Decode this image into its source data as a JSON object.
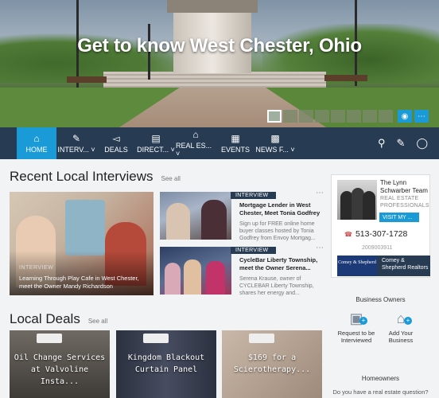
{
  "hero": {
    "title": "Get to know West Chester, Ohio",
    "camera_icon": "camera-icon",
    "more_icon": "more-icon"
  },
  "nav": {
    "items": [
      {
        "label": "HOME",
        "icon": "home-icon",
        "active": true
      },
      {
        "label": "INTERV...",
        "icon": "interviews-icon"
      },
      {
        "label": "DEALS",
        "icon": "tag-icon"
      },
      {
        "label": "DIRECT...",
        "icon": "directory-icon"
      },
      {
        "label": "REAL ES...",
        "icon": "real-estate-icon"
      },
      {
        "label": "EVENTS",
        "icon": "calendar-icon"
      },
      {
        "label": "NEWS F...",
        "icon": "news-icon"
      }
    ],
    "right_icons": [
      "search-icon",
      "edit-icon",
      "user-icon"
    ]
  },
  "interviews": {
    "title": "Recent Local Interviews",
    "see_all": "See all",
    "featured": {
      "label": "INTERVIEW",
      "title": "Learning Through Play Cafe in West Chester, meet the Owner Mandy Richardson"
    },
    "items": [
      {
        "badge": "INTERVIEW",
        "title": "Mortgage Lender in West Chester, Meet Tonia Godfrey",
        "desc": "Sign up for FREE online home buyer classes hosted by Tonia Godfrey from Envoy Mortgag..."
      },
      {
        "badge": "INTERVIEW",
        "title": "CycleBar Liberty Township, meet the Owner Serena...",
        "desc": "Serena Krause, owner of CYCLEBAR Liberty Township, shares her energy and..."
      }
    ]
  },
  "deals": {
    "title": "Local Deals",
    "see_all": "See all",
    "items": [
      {
        "text": "Oil Change Services at Valvoline Insta..."
      },
      {
        "text": "Kingdom Blackout Curtain Panel"
      },
      {
        "text": "$169 for a Scierotherapy..."
      }
    ]
  },
  "agent": {
    "name": "The Lynn Schwarber Team",
    "role": "REAL ESTATE PROFESSIONALS",
    "visit": "VISIT MY ...",
    "phone": "513-307-1728",
    "license": "2009003911",
    "broker_logo": "Comey & Shepherd",
    "broker": "Comey & Shepherd Realtors"
  },
  "business_owners": {
    "title": "Business Owners",
    "actions": [
      {
        "label": "Request to be Interviewed",
        "icon": "chat-bubble-icon"
      },
      {
        "label": "Add Your Business",
        "icon": "storefront-icon"
      }
    ]
  },
  "homeowners": {
    "title": "Homeowners",
    "question": "Do you have a real estate question?"
  },
  "colors": {
    "nav_bg": "#273b53",
    "accent": "#1a9bd7"
  }
}
